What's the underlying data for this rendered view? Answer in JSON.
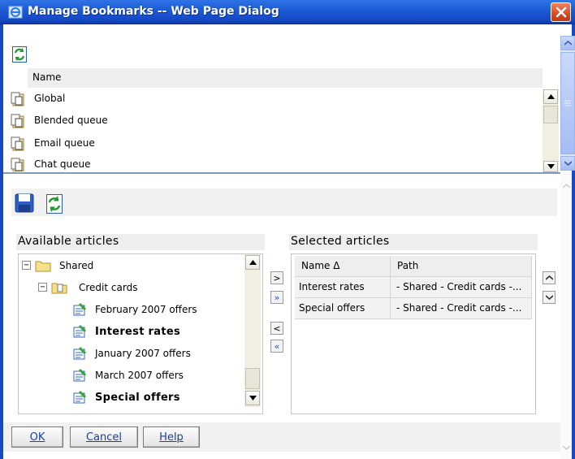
{
  "window": {
    "title": "Manage Bookmarks -- Web Page Dialog",
    "icon": "ie-icon",
    "close_icon": "close-icon"
  },
  "top_pane": {
    "refresh_icon": "refresh-icon",
    "column_header": "Name",
    "rows": [
      {
        "label": "Global",
        "icon": "queue-icon"
      },
      {
        "label": "Blended queue",
        "icon": "queue-icon"
      },
      {
        "label": "Email queue",
        "icon": "queue-icon"
      },
      {
        "label": "Chat queue",
        "icon": "queue-icon"
      }
    ]
  },
  "bottom_pane": {
    "save_icon": "save-icon",
    "refresh_icon": "refresh-icon",
    "available": {
      "header": "Available articles",
      "tree": [
        {
          "label": "Shared",
          "level": 0,
          "type": "folder",
          "expander": "−",
          "bold": false
        },
        {
          "label": "Credit cards",
          "level": 1,
          "type": "folder",
          "expander": "−",
          "bold": false
        },
        {
          "label": "February 2007 offers",
          "level": 2,
          "type": "article",
          "bold": false
        },
        {
          "label": "Interest rates",
          "level": 2,
          "type": "article",
          "bold": true
        },
        {
          "label": "January 2007 offers",
          "level": 2,
          "type": "article",
          "bold": false
        },
        {
          "label": "March 2007 offers",
          "level": 2,
          "type": "article",
          "bold": false
        },
        {
          "label": "Special offers",
          "level": 2,
          "type": "article",
          "bold": true
        }
      ]
    },
    "move_buttons": [
      {
        "glyph": ">",
        "name": "add-selected-button"
      },
      {
        "glyph": "»",
        "name": "add-all-button"
      },
      {
        "glyph": "<",
        "name": "remove-selected-button"
      },
      {
        "glyph": "«",
        "name": "remove-all-button"
      }
    ],
    "selected": {
      "header": "Selected articles",
      "columns": [
        "Name Δ",
        "Path"
      ],
      "rows": [
        [
          "Interest rates",
          "- Shared - Credit cards -..."
        ],
        [
          "Special offers",
          "- Shared - Credit cards -..."
        ]
      ]
    },
    "order_buttons": [
      {
        "glyph": "^",
        "name": "move-up-button"
      },
      {
        "glyph": "v",
        "name": "move-down-button"
      }
    ]
  },
  "buttons": {
    "ok_label": "OK",
    "cancel_label": "Cancel",
    "help_label": "Help"
  },
  "colors": {
    "titlebar": "#1b59d4",
    "close": "#d94a25",
    "link_blue": "#1b3fa0"
  }
}
